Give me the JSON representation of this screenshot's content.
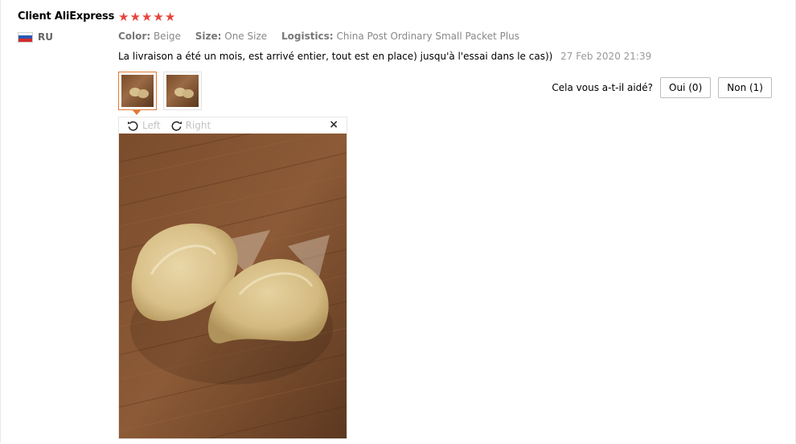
{
  "user": {
    "name": "Client AliExpress",
    "country_code": "RU",
    "flag_colors": [
      "#ffffff",
      "#2b59b5",
      "#d52b2b"
    ]
  },
  "rating": {
    "stars": 5,
    "star_char": "★",
    "color": "#e8433b"
  },
  "attributes": [
    {
      "label": "Color:",
      "value": "Beige"
    },
    {
      "label": "Size:",
      "value": "One Size"
    },
    {
      "label": "Logistics:",
      "value": "China Post Ordinary Small Packet Plus"
    }
  ],
  "review": {
    "text": "La livraison a été un mois, est arrivé entier, tout est en place) jusqu'à l'essai dans le cas))",
    "date": "27 Feb 2020 21:39"
  },
  "helpful": {
    "question": "Cela vous a-t-il aidé?",
    "yes_label": "Oui (0)",
    "no_label": "Non (1)"
  },
  "viewer": {
    "rotate_left_label": "Left",
    "rotate_right_label": "Right",
    "close_label": "×",
    "icons": [
      "rotate-left-icon",
      "rotate-right-icon",
      "close-icon"
    ]
  },
  "accent_color": "#e07a33"
}
